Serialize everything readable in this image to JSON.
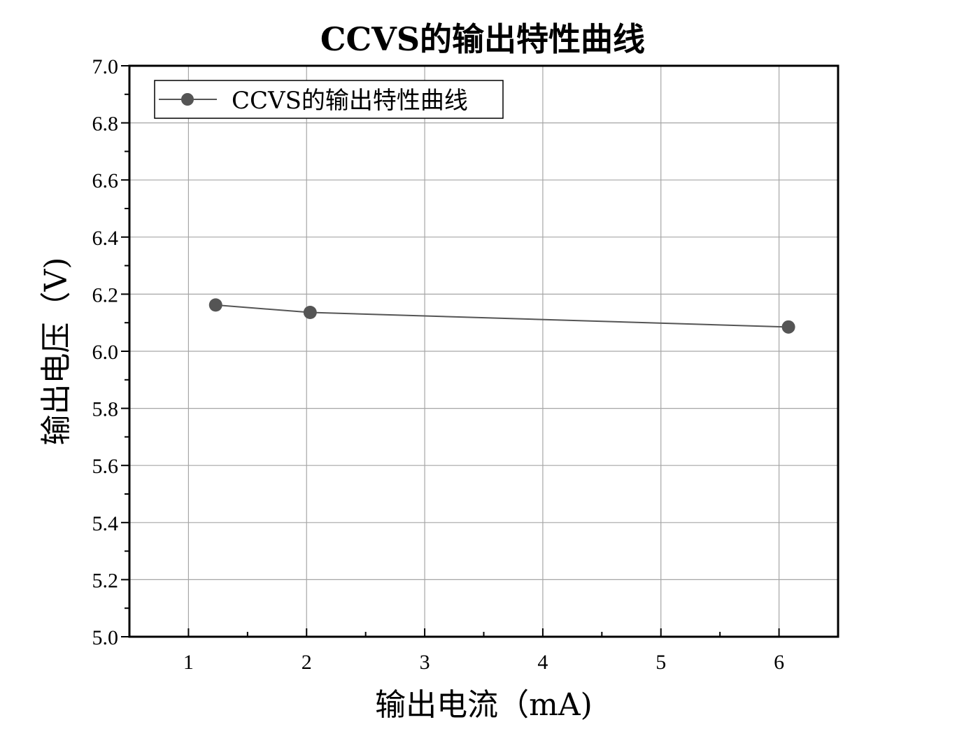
{
  "chart_data": {
    "type": "line",
    "title": "CCVS的输出特性曲线",
    "xlabel": "输出电流（mA)",
    "ylabel": "输出电压（V)",
    "xlim": [
      0.5,
      6.5
    ],
    "ylim": [
      5.0,
      7.0
    ],
    "x_ticks": [
      1,
      2,
      3,
      4,
      5,
      6
    ],
    "x_tick_labels": [
      "1",
      "2",
      "3",
      "4",
      "5",
      "6"
    ],
    "y_ticks": [
      5.0,
      5.2,
      5.4,
      5.6,
      5.8,
      6.0,
      6.2,
      6.4,
      6.6,
      6.8,
      7.0
    ],
    "y_tick_labels": [
      "5.0",
      "5.2",
      "5.4",
      "5.6",
      "5.8",
      "6.0",
      "6.2",
      "6.4",
      "6.6",
      "6.8",
      "7.0"
    ],
    "grid": true,
    "legend_position": "top-left",
    "series": [
      {
        "name": "CCVS的输出特性曲线",
        "color": "#555555",
        "marker": "circle",
        "x": [
          1.23,
          2.03,
          6.08
        ],
        "y": [
          6.162,
          6.136,
          6.085
        ]
      }
    ]
  }
}
